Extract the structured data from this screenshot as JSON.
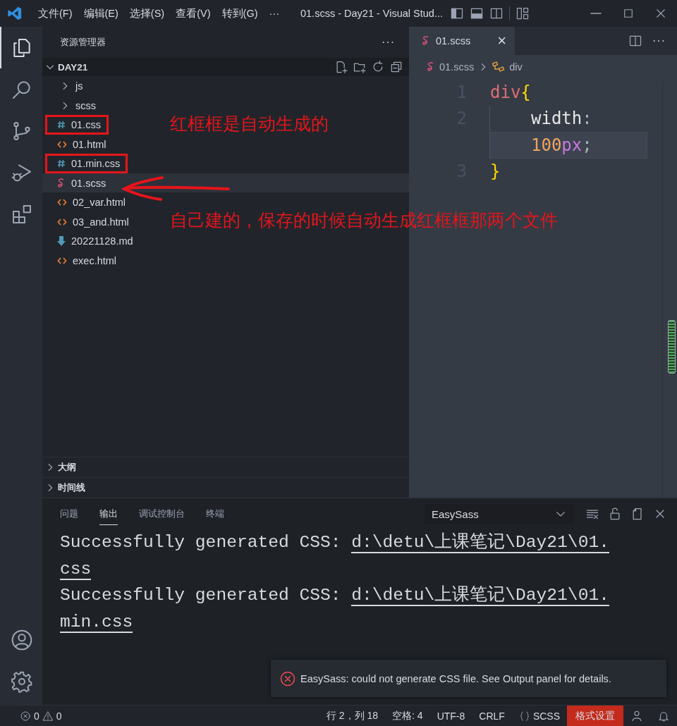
{
  "title_bar": {
    "menus": [
      "文件(F)",
      "编辑(E)",
      "选择(S)",
      "查看(V)",
      "转到(G)"
    ],
    "more": "···",
    "title": "01.scss - Day21 - Visual Stud..."
  },
  "activity_bar": {
    "items": [
      {
        "kind": "explorer",
        "selected": true
      },
      {
        "kind": "search",
        "selected": false
      },
      {
        "kind": "source-control",
        "selected": false
      },
      {
        "kind": "run-debug",
        "selected": false
      },
      {
        "kind": "extensions",
        "selected": false
      }
    ],
    "bottom": [
      {
        "kind": "account"
      },
      {
        "kind": "settings"
      }
    ]
  },
  "sidebar": {
    "title": "资源管理器",
    "more": "···",
    "folder": {
      "name": "DAY21",
      "expanded": true,
      "children": [
        {
          "name": "js",
          "kind": "folder",
          "expanded": false,
          "selected": false,
          "boxed": false
        },
        {
          "name": "scss",
          "kind": "folder",
          "expanded": false,
          "selected": false,
          "boxed": false
        },
        {
          "name": "01.css",
          "kind": "css",
          "selected": false,
          "boxed": true,
          "note": "红框框是自动生成的"
        },
        {
          "name": "01.html",
          "kind": "html",
          "selected": false,
          "boxed": false
        },
        {
          "name": "01.min.css",
          "kind": "css",
          "selected": false,
          "boxed": true
        },
        {
          "name": "01.scss",
          "kind": "scss",
          "selected": true,
          "boxed": false
        },
        {
          "name": "02_var.html",
          "kind": "html",
          "selected": false,
          "boxed": false
        },
        {
          "name": "03_and.html",
          "kind": "html",
          "selected": false,
          "boxed": false,
          "note": "自己建的，保存的时候自动生成红框框那两个文件"
        },
        {
          "name": "20221128.md",
          "kind": "md",
          "selected": false,
          "boxed": false
        },
        {
          "name": "exec.html",
          "kind": "html",
          "selected": false,
          "boxed": false
        }
      ]
    },
    "sections": [
      {
        "label": "大纲",
        "expanded": false
      },
      {
        "label": "时间线",
        "expanded": false
      }
    ]
  },
  "editor": {
    "tabs": [
      {
        "label": "01.scss",
        "selected": true,
        "close": "×"
      }
    ],
    "more": "···",
    "breadcrumb": [
      {
        "label": "01.scss",
        "kind": "scss"
      },
      {
        "label": "div",
        "kind": "symbol"
      }
    ],
    "lines": [
      {
        "number": "1",
        "rows": [
          {
            "current": false,
            "indented": false,
            "tokens": [
              {
                "kind": "selector",
                "text": "div"
              },
              {
                "kind": "brace",
                "text": "{"
              }
            ]
          }
        ]
      },
      {
        "number": "2",
        "rows": [
          {
            "current": false,
            "indented": true,
            "tokens": [
              {
                "kind": "property",
                "text": "width"
              },
              {
                "kind": "punct",
                "text": ":"
              }
            ]
          },
          {
            "current": true,
            "indented": true,
            "tokens": [
              {
                "kind": "number",
                "text": "100"
              },
              {
                "kind": "unit",
                "text": "px"
              },
              {
                "kind": "punct",
                "text": ";"
              }
            ]
          }
        ]
      },
      {
        "number": "3",
        "rows": [
          {
            "current": false,
            "indented": false,
            "tokens": [
              {
                "kind": "brace",
                "text": "}"
              }
            ]
          }
        ]
      }
    ]
  },
  "panel": {
    "tabs": [
      {
        "label": "问题",
        "selected": false
      },
      {
        "label": "输出",
        "selected": true
      },
      {
        "label": "调试控制台",
        "selected": false
      },
      {
        "label": "终端",
        "selected": false
      }
    ],
    "channel": "EasySass",
    "output": [
      {
        "text": "Successfully generated CSS: ",
        "path": "d:\\detu\\上课笔记\\Day21\\01.css"
      },
      {
        "text": "Successfully generated CSS: ",
        "path": "d:\\detu\\上课笔记\\Day21\\01.min.css"
      }
    ]
  },
  "notification": {
    "kind": "error",
    "message": "EasySass: could not generate CSS file. See Output panel for details."
  },
  "status_bar": {
    "errors": "0",
    "warnings": "0",
    "items": [
      "行 2，列 18",
      "空格: 4",
      "UTF-8",
      "CRLF"
    ],
    "language": "SCSS",
    "format_button": "格式设置"
  }
}
